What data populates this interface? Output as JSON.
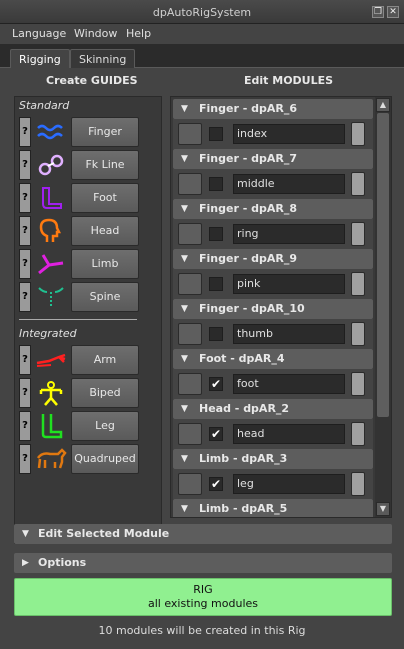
{
  "window": {
    "title": "dpAutoRigSystem"
  },
  "menu": [
    "Language",
    "Window",
    "Help"
  ],
  "tabs": [
    {
      "label": "Rigging",
      "active": true
    },
    {
      "label": "Skinning",
      "active": false
    }
  ],
  "guides": {
    "heading": "Create GUIDES",
    "standard_label": "Standard",
    "integrated_label": "Integrated",
    "help_label": "?",
    "standard": [
      {
        "label": "Finger",
        "icon": "finger-guide-icon"
      },
      {
        "label": "Fk Line",
        "icon": "fkline-guide-icon"
      },
      {
        "label": "Foot",
        "icon": "foot-guide-icon"
      },
      {
        "label": "Head",
        "icon": "head-guide-icon"
      },
      {
        "label": "Limb",
        "icon": "limb-guide-icon"
      },
      {
        "label": "Spine",
        "icon": "spine-guide-icon"
      }
    ],
    "integrated": [
      {
        "label": "Arm",
        "icon": "arm-guide-icon"
      },
      {
        "label": "Biped",
        "icon": "biped-guide-icon"
      },
      {
        "label": "Leg",
        "icon": "leg-guide-icon"
      },
      {
        "label": "Quadruped",
        "icon": "quadruped-guide-icon"
      }
    ]
  },
  "modules": {
    "heading": "Edit MODULES",
    "items": [
      {
        "title": "Finger - dpAR_6",
        "name": "index",
        "checked": false
      },
      {
        "title": "Finger - dpAR_7",
        "name": "middle",
        "checked": false
      },
      {
        "title": "Finger - dpAR_8",
        "name": "ring",
        "checked": false
      },
      {
        "title": "Finger - dpAR_9",
        "name": "pink",
        "checked": false
      },
      {
        "title": "Finger - dpAR_10",
        "name": "thumb",
        "checked": false
      },
      {
        "title": "Foot - dpAR_4",
        "name": "foot",
        "checked": true
      },
      {
        "title": "Head - dpAR_2",
        "name": "head",
        "checked": true
      },
      {
        "title": "Limb - dpAR_3",
        "name": "leg",
        "checked": true
      },
      {
        "title": "Limb - dpAR_5",
        "name": "",
        "checked": false
      }
    ]
  },
  "edit_selected": {
    "label": "Edit Selected Module"
  },
  "options": {
    "label": "Options"
  },
  "rig_button": {
    "line1": "RIG",
    "line2": "all existing modules"
  },
  "info_text": "10 modules will be created in this Rig",
  "colors": {
    "rig_button": "#90f090",
    "panel": "#444444"
  }
}
